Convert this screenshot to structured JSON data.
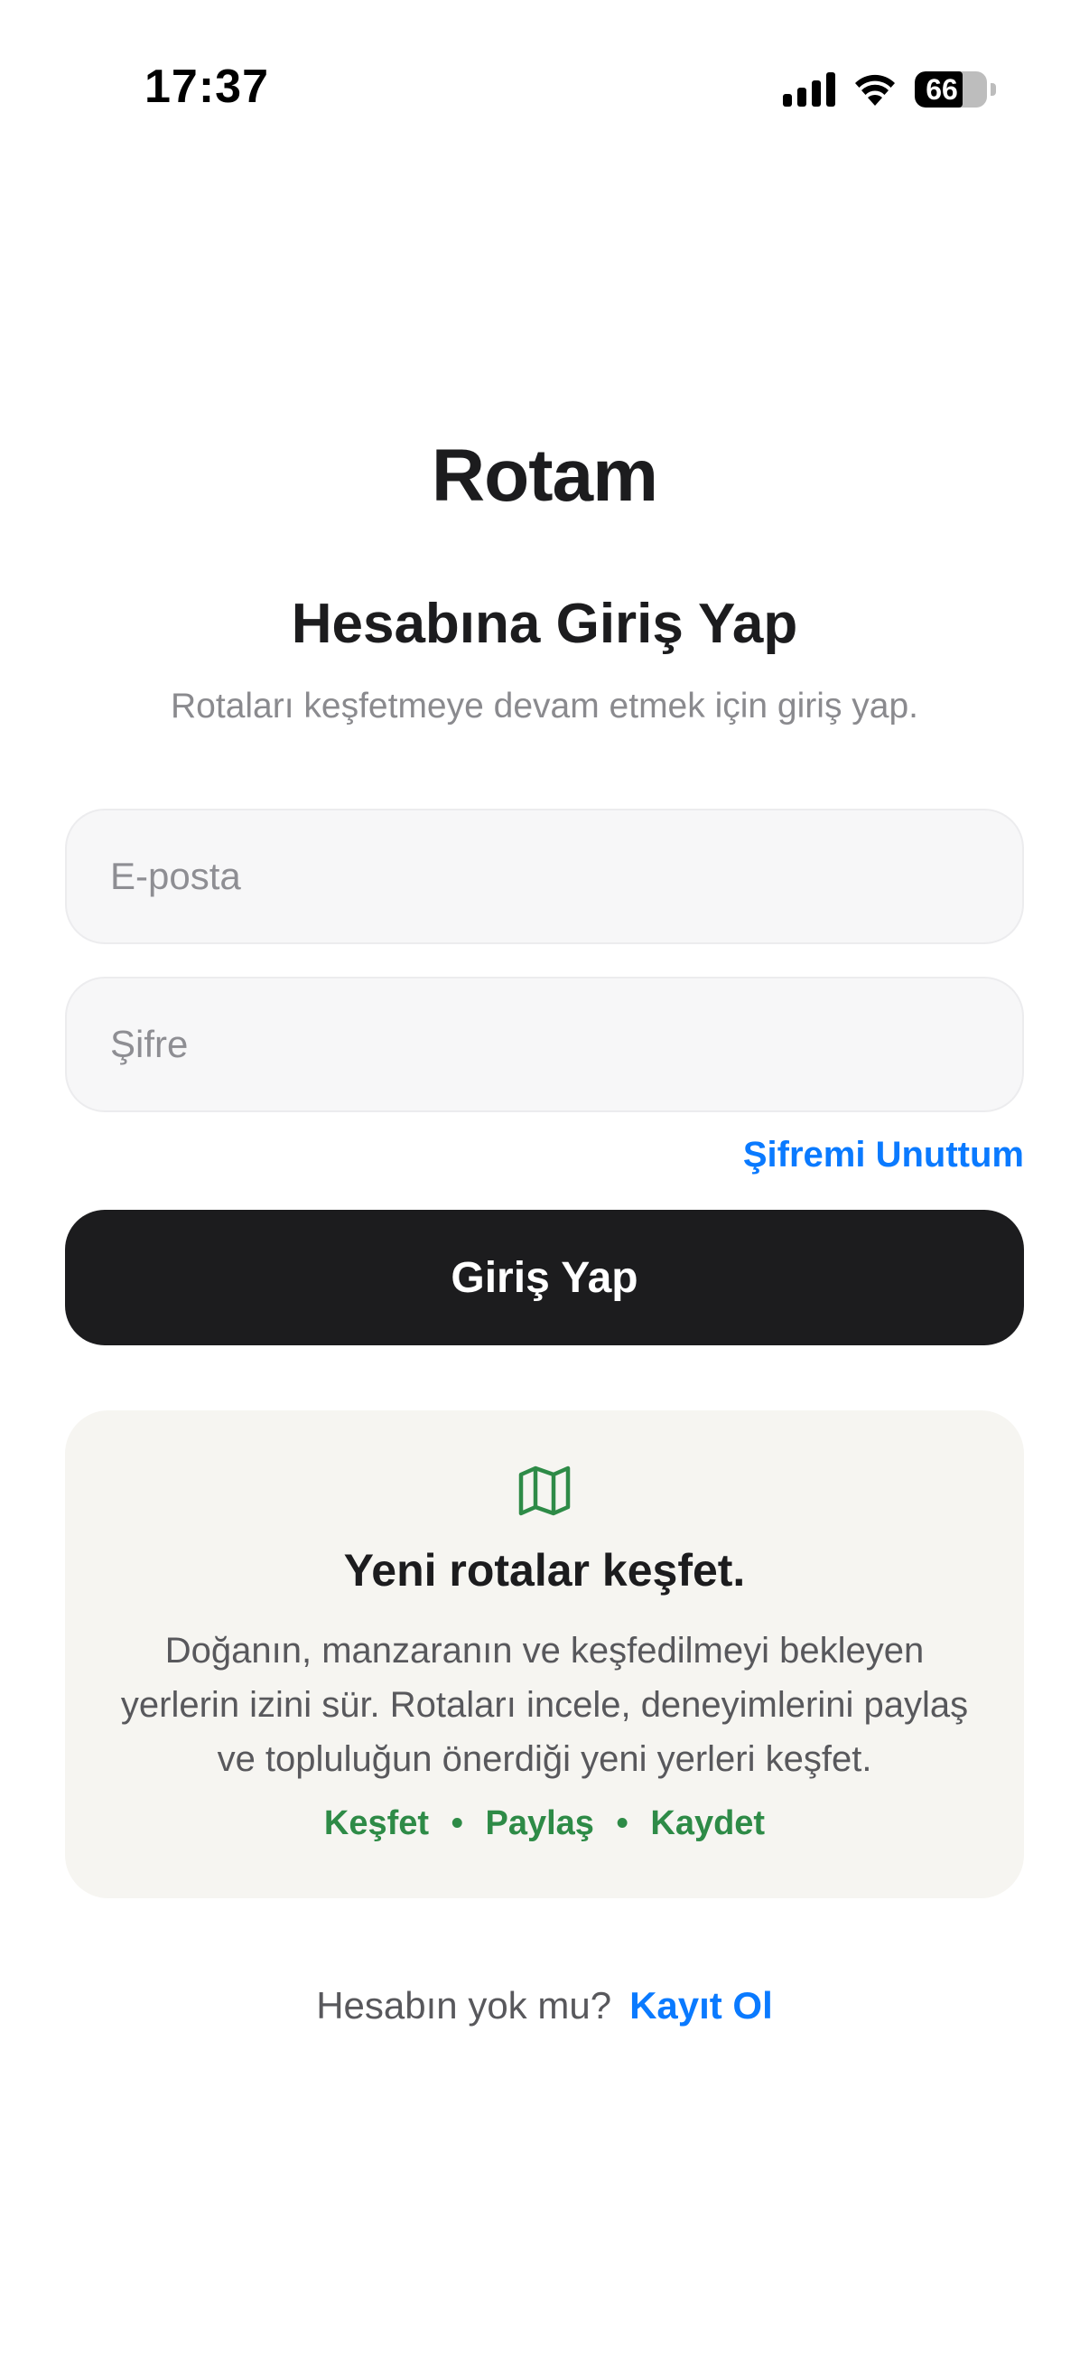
{
  "status_bar": {
    "time": "17:37",
    "battery_percent": "66",
    "battery_level": 0.66,
    "icons": [
      "signal-icon",
      "wifi-icon",
      "battery-icon"
    ]
  },
  "app": {
    "title": "Rotam"
  },
  "login": {
    "heading": "Hesabına Giriş Yap",
    "subtitle": "Rotaları keşfetmeye devam etmek için giriş yap.",
    "email_placeholder": "E-posta",
    "email_value": "",
    "password_placeholder": "Şifre",
    "password_value": "",
    "forgot_password": "Şifremi Unuttum",
    "submit_label": "Giriş Yap"
  },
  "info_card": {
    "icon": "map-icon",
    "title": "Yeni rotalar keşfet.",
    "body_lines": [
      "Doğanın, manzaranın ve keşfedilmeyi bekleyen",
      "yerlerin izini sür. Rotaları incele, deneyimlerini paylaş",
      "ve topluluğun önerdiği yeni yerleri keşfet."
    ],
    "tags": [
      "Keşfet",
      "Paylaş",
      "Kaydet"
    ],
    "tag_separator": "•"
  },
  "footer": {
    "question": "Hesabın yok mu?",
    "register_link": "Kayıt Ol"
  },
  "colors": {
    "primary_text": "#1c1c1e",
    "secondary_text": "#8a8a8e",
    "link": "#0a7aff",
    "accent_green": "#2e8b47",
    "button_background": "#1c1c1e",
    "card_background": "#f6f5f1",
    "input_background": "#f7f7f8"
  }
}
